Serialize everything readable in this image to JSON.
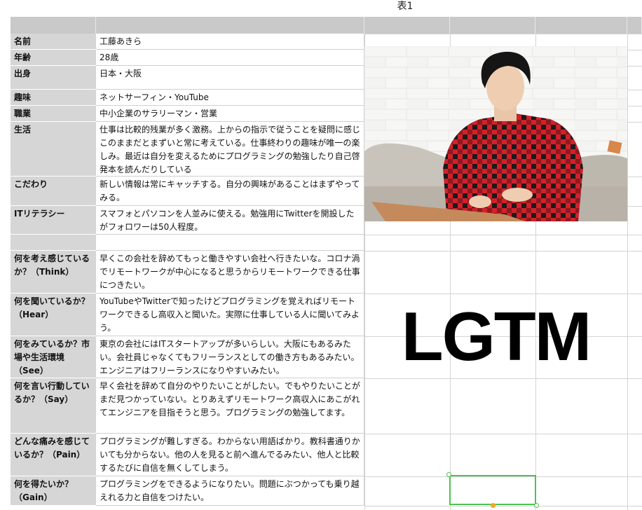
{
  "sheet_title": "表1",
  "rows": [
    {
      "key": "名前",
      "value": "工藤あきら"
    },
    {
      "key": "年齢",
      "value": "28歳"
    },
    {
      "key": "出身",
      "value": "日本・大阪"
    },
    {
      "key": "趣味",
      "value": "ネットサーフィン・YouTube"
    },
    {
      "key": "職業",
      "value": "中小企業のサラリーマン・営業"
    },
    {
      "key": "生活",
      "value": "仕事は比較的残業が多く激務。上からの指示で従うことを疑問に感じこのままだとまずいと常に考えている。仕事終わりの趣味が唯一の楽しみ。最近は自分を変えるためにプログラミングの勉強したり自己啓発本を読んだりしている"
    },
    {
      "key": "こだわり",
      "value": "新しい情報は常にキャッチする。自分の興味があることはまずやってみる。"
    },
    {
      "key": "ITリテラシー",
      "value": "スマフォとパソコンを人並みに使える。勉強用にTwitterを開設したがフォロワーは50人程度。"
    },
    {
      "key": "",
      "value": ""
    },
    {
      "key": "何を考え感じているか？（Think）",
      "value": "早くこの会社を辞めてもっと働きやすい会社へ行きたいな。コロナ渦でリモートワークが中心になると思うからリモートワークできる仕事につきたい。"
    },
    {
      "key": "何を聞いているか？（Hear）",
      "value": "YouTubeやTwitterで知ったけどプログラミングを覚えればリモートワークできるし高収入と聞いた。実際に仕事している人に聞いてみよう。"
    },
    {
      "key": "何をみているか？市場や生活環境（See）",
      "value": "東京の会社にはITスタートアップが多いらしい。大阪にもあるみたい。会社員じゃなくてもフリーランスとしての働き方もあるみたい。エンジニアはフリーランスになりやすいみたい。"
    },
    {
      "key": "何を言い行動しているか？（Say）",
      "value": "早く会社を辞めて自分のやりたいことがしたい。でもやりたいことがまだ見つかっていない。とりあえずリモートワーク高収入にあこがれてエンジニアを目指そうと思う。プログラミングの勉強してます。"
    },
    {
      "key": "どんな痛みを感じているか？（Pain）",
      "value": "プログラミングが難しすぎる。わからない用語ばかり。教科書通りかいても分からない。他の人を見ると前へ進んでるみたい、他人と比較するたびに自信を無くしてしまう。"
    },
    {
      "key": "何を得たいか？（Gain）",
      "value": "プログラミングをできるようになりたい。問題にぶつかっても乗り越えれる力と自信をつけたい。"
    }
  ],
  "overlay_text": "LGTM",
  "photo": {
    "description_icon": "person-with-laptop-photo",
    "shirt_red": "#d4202a",
    "shirt_dark": "#1a1a1a"
  },
  "colors": {
    "header_gray": "#c9c9c9",
    "key_gray": "#d6d6d6",
    "selection_green": "#4fc24f",
    "handle_orange": "#f5a623"
  }
}
